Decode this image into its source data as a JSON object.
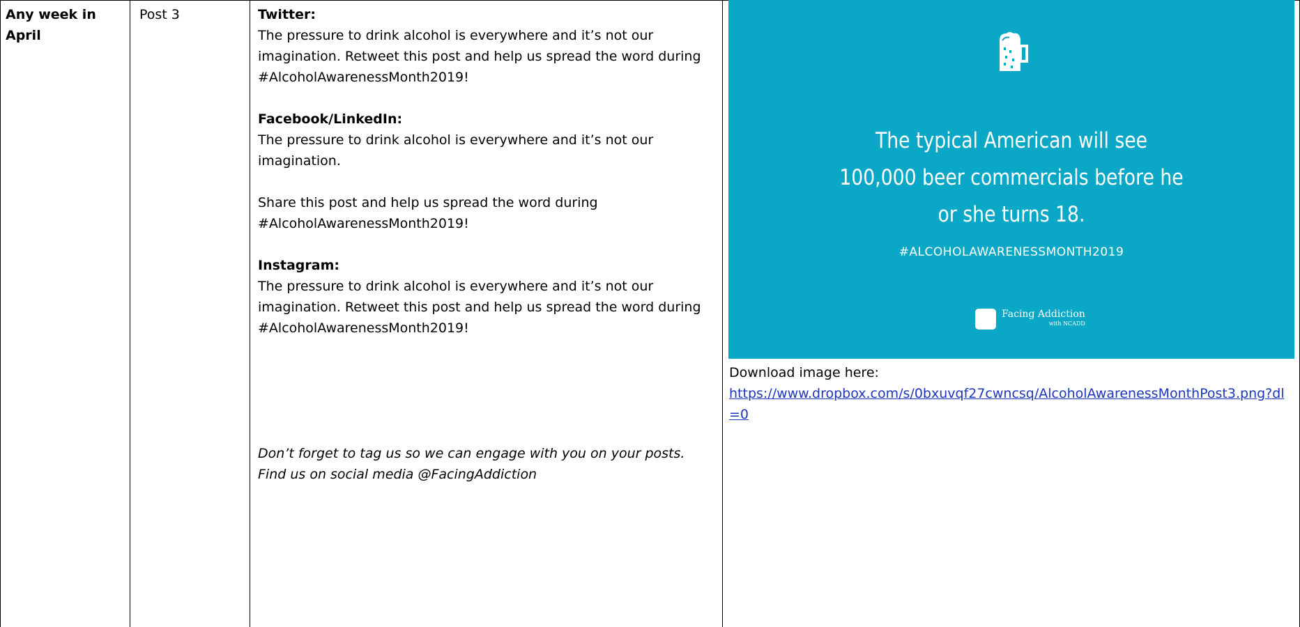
{
  "row": {
    "timing": "Any week in April",
    "post_label": "Post 3",
    "twitter": {
      "heading": "Twitter:",
      "text": "The pressure to drink alcohol is everywhere and it’s not our imagination. Retweet this post and help us spread the word during #AlcoholAwarenessMonth2019!"
    },
    "facebook": {
      "heading": "Facebook/LinkedIn:",
      "text1": "The pressure to drink alcohol is everywhere and it’s not our imagination.",
      "text2": "Share this post and help us spread the word during #AlcoholAwarenessMonth2019!"
    },
    "instagram": {
      "heading": "Instagram:",
      "text": "The pressure to drink alcohol is everywhere and it’s not our imagination. Retweet this post and help us spread the word during #AlcoholAwarenessMonth2019!"
    },
    "footer_note": "Don’t forget to tag us so we can engage with you on your posts. Find us on social media @FacingAddiction",
    "promo_image": {
      "icon": "beer-mug-icon",
      "headline_lines": [
        "The typical American will see",
        "100,000 beer commercials before he",
        "or she turns 18."
      ],
      "hashtag": "#ALCOHOLAWARENESSMONTH2019",
      "logo_text": "Facing Addiction",
      "logo_sub": "with NCADD",
      "background_color": "#0aa8c6"
    },
    "download_label": "Download image here:",
    "download_url": "https://www.dropbox.com/s/0bxuvqf27cwncsq/AlcoholAwarenessMonthPost3.png?dl=0"
  }
}
